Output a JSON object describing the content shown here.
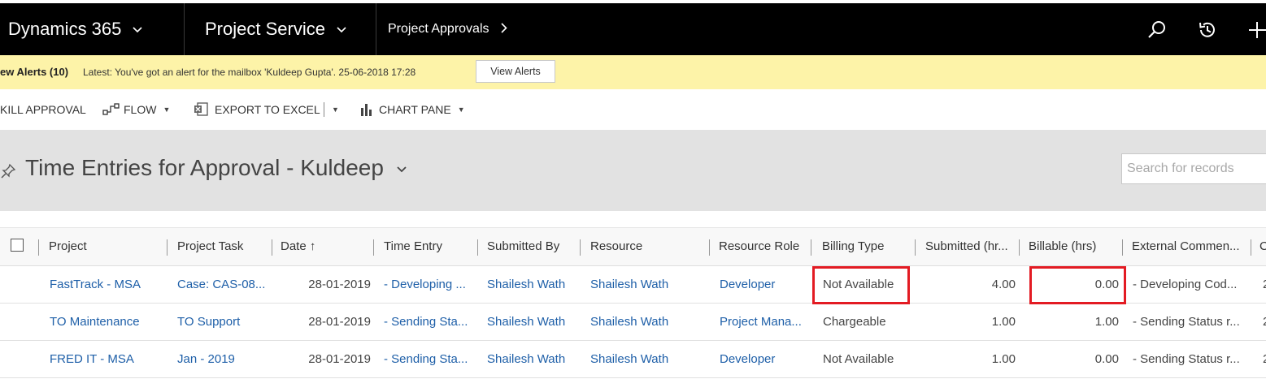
{
  "topnav": {
    "app": "Dynamics 365",
    "area": "Project Service",
    "page": "Project Approvals",
    "chevron_down": "⌄",
    "chevron_right": "›",
    "icons": [
      "search-icon",
      "history-icon",
      "add-icon"
    ]
  },
  "alert": {
    "count_label": "ew Alerts (10)",
    "message": "Latest: You've got an alert for the mailbox 'Kuldeep Gupta'. 25-06-2018 17:28",
    "button": "View Alerts"
  },
  "commands": {
    "approval": "KILL APPROVAL",
    "flow": "FLOW",
    "export": "EXPORT TO EXCEL",
    "chart": "CHART PANE"
  },
  "view": {
    "title": "Time Entries for Approval - Kuldeep",
    "search_placeholder": "Search for records"
  },
  "grid": {
    "columns": [
      "Project",
      "Project Task",
      "Date ↑",
      "Time Entry",
      "Submitted By",
      "Resource",
      "Resource Role",
      "Billing Type",
      "Submitted (hr...",
      "Billable (hrs)",
      "External Commen...",
      "C"
    ],
    "rows": [
      [
        "FastTrack - MSA",
        "Case: CAS-08...",
        "28-01-2019",
        "- Developing ...",
        "Shailesh Wath",
        "Shailesh Wath",
        "Developer",
        "Not Available",
        "4.00",
        "0.00",
        "- Developing Cod...",
        "2"
      ],
      [
        "TO Maintenance",
        "TO Support",
        "28-01-2019",
        "- Sending Sta...",
        "Shailesh Wath",
        "Shailesh Wath",
        "Project Mana...",
        "Chargeable",
        "1.00",
        "1.00",
        "- Sending Status r...",
        "2"
      ],
      [
        "FRED IT - MSA",
        "Jan - 2019",
        "28-01-2019",
        "- Sending Sta...",
        "Shailesh Wath",
        "Shailesh Wath",
        "Developer",
        "Not Available",
        "1.00",
        "0.00",
        "- Sending Status r...",
        "2"
      ]
    ]
  },
  "colors": {
    "nav_bg": "#000000",
    "alert_bg": "#fdf3a8",
    "link": "#1e5fa8",
    "highlight": "#e31b23",
    "view_header_bg": "#e2e2e2"
  }
}
